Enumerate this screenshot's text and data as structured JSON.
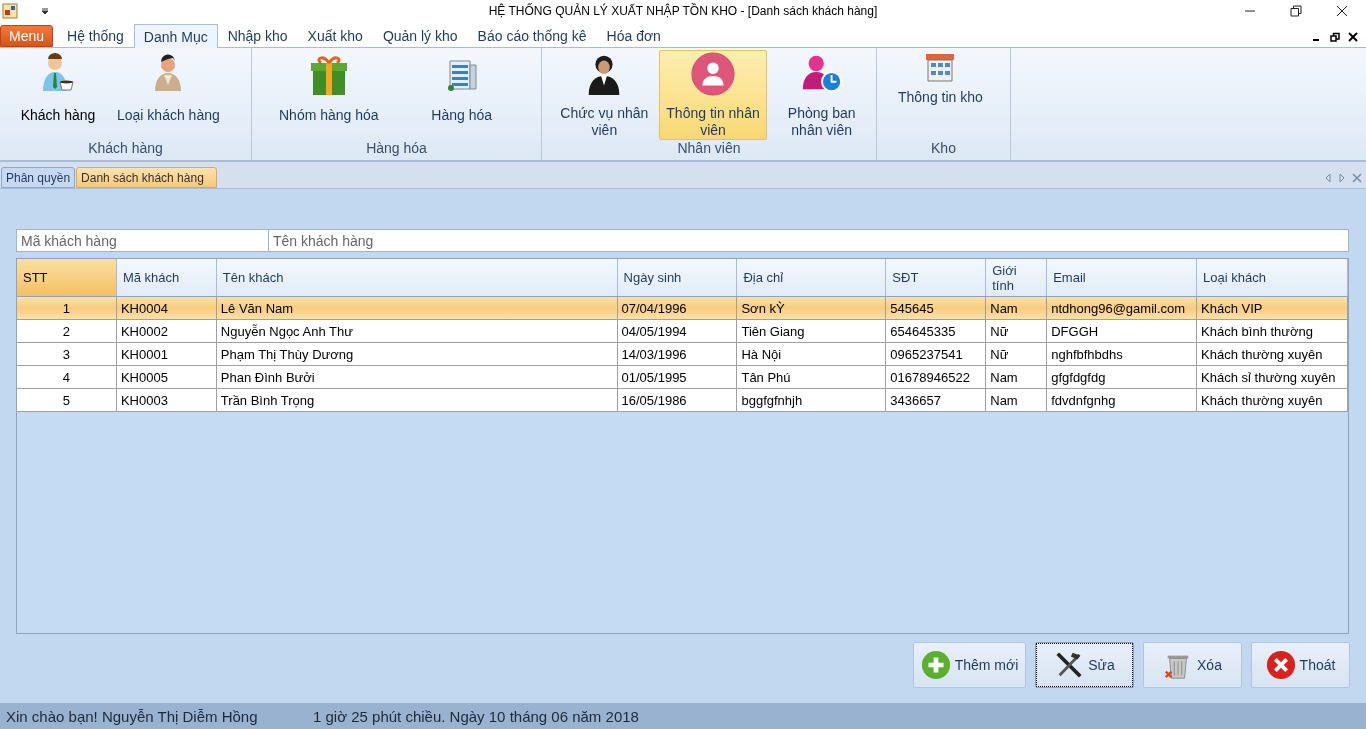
{
  "window": {
    "title": "HỆ THỐNG QUẢN LÝ XUẤT NHẬP TỒN KHO - [Danh sách khách hàng]"
  },
  "menu_tabs": [
    {
      "label": "Menu",
      "kind": "app",
      "selected": false
    },
    {
      "label": "Hệ thống",
      "kind": "tab",
      "selected": false
    },
    {
      "label": "Danh Mục",
      "kind": "tab",
      "selected": true
    },
    {
      "label": "Nhập kho",
      "kind": "tab",
      "selected": false
    },
    {
      "label": "Xuất kho",
      "kind": "tab",
      "selected": false
    },
    {
      "label": "Quản lý kho",
      "kind": "tab",
      "selected": false
    },
    {
      "label": "Báo cáo thống kê",
      "kind": "tab",
      "selected": false
    },
    {
      "label": "Hóa đơn",
      "kind": "tab",
      "selected": false
    }
  ],
  "ribbon_groups": [
    {
      "title": "Khách hàng",
      "buttons": [
        {
          "label": "Khách hàng",
          "kind": "customer",
          "selected": false
        },
        {
          "label": "Loại khách hàng",
          "kind": "customer-type",
          "selected": false
        }
      ]
    },
    {
      "title": "Hàng hóa",
      "buttons": [
        {
          "label": "Nhóm hàng hóa",
          "kind": "gift",
          "selected": false
        },
        {
          "label": "Hàng hóa",
          "kind": "office",
          "selected": false
        }
      ]
    },
    {
      "title": "Nhân viên",
      "buttons": [
        {
          "label": "Chức vụ nhân viên",
          "kind": "staff",
          "selected": false
        },
        {
          "label": "Thông tin nhân viên",
          "kind": "staff-info",
          "selected": true
        },
        {
          "label": "Phòng ban nhân viên",
          "kind": "staff-clock",
          "selected": false
        }
      ]
    },
    {
      "title": "Kho",
      "buttons": [
        {
          "label": "Thông tin kho",
          "kind": "warehouse",
          "selected": false
        }
      ]
    }
  ],
  "document_tabs": [
    {
      "label": "Phân quyền",
      "selected": false
    },
    {
      "label": "Danh sách khách hàng",
      "selected": true
    }
  ],
  "filters": [
    {
      "placeholder": "Mã khách hàng"
    },
    {
      "placeholder": "Tên khách hàng"
    }
  ],
  "table": {
    "columns": [
      "STT",
      "Mã khách",
      "Tên khách",
      "Ngày sinh",
      "Địa chỉ",
      "SĐT",
      "Giới tính",
      "Email",
      "Loại khách"
    ],
    "rows": [
      {
        "selected": true,
        "cells": [
          "1",
          "KH0004",
          "Lê Văn Nam",
          "07/04/1996",
          "Sơn kỲ",
          "545645",
          "Nam",
          "ntdhong96@gamil.com",
          "Khách VIP"
        ]
      },
      {
        "selected": false,
        "cells": [
          "2",
          "KH0002",
          "Nguyễn Ngọc Anh Thư",
          "04/05/1994",
          "Tiên Giang",
          "654645335",
          "Nữ",
          "DFGGH",
          "Khách bình thường"
        ]
      },
      {
        "selected": false,
        "cells": [
          "3",
          "KH0001",
          "Phạm Thị Thùy Dương",
          "14/03/1996",
          "Hà Nội",
          "0965237541",
          "Nữ",
          "nghfbfhbdhs",
          "Khách thường xuyên"
        ]
      },
      {
        "selected": false,
        "cells": [
          "4",
          "KH0005",
          "Phan Đình Bưởi",
          "01/05/1995",
          "Tân Phú",
          "01678946522",
          "Nam",
          "gfgfdgfdg",
          "Khách sỉ thường xuyên"
        ]
      },
      {
        "selected": false,
        "cells": [
          "5",
          "KH0003",
          "Trần Bình Trọng",
          "16/05/1986",
          "bggfgfnhjh",
          "3436657",
          "Nam",
          "fdvdnfgnhg",
          "Khách thường xuyên"
        ]
      }
    ]
  },
  "actions": [
    {
      "label": "Thêm mới",
      "kind": "add",
      "focused": false
    },
    {
      "label": "Sửa",
      "kind": "edit",
      "focused": true
    },
    {
      "label": "Xóa",
      "kind": "delete",
      "focused": false
    },
    {
      "label": "Thoát",
      "kind": "exit",
      "focused": false
    }
  ],
  "status_bar": {
    "greeting": "Xin chào bạn! Nguyễn Thị Diễm Hồng",
    "time": "1 giờ 25 phút chiều. Ngày 10 tháng 06 năm 2018"
  }
}
